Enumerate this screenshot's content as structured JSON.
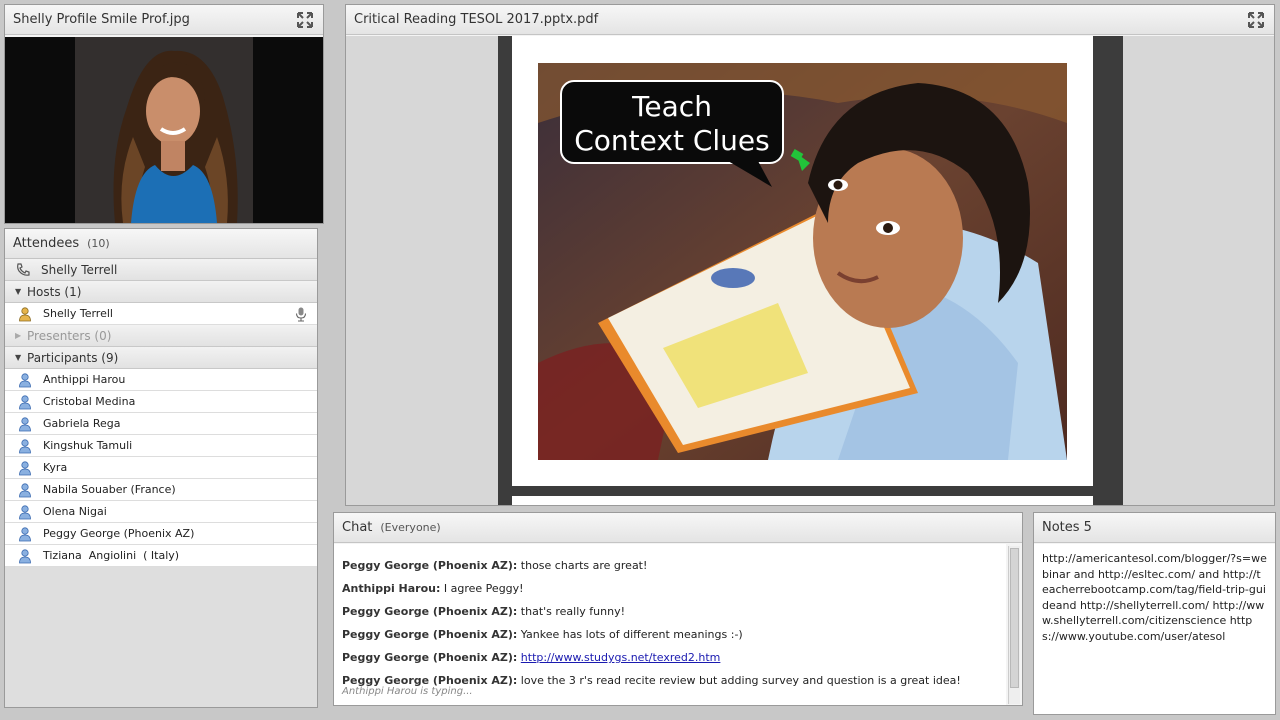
{
  "camera": {
    "title": "Shelly Profile Smile Prof.jpg"
  },
  "share": {
    "title": "Critical Reading TESOL 2017.pptx.pdf",
    "slide": {
      "bubble_line1": "Teach",
      "bubble_line2": "Context Clues"
    }
  },
  "attendees": {
    "title": "Attendees",
    "count": "(10)",
    "me": "Shelly Terrell",
    "hosts_label": "Hosts (1)",
    "hosts": [
      "Shelly Terrell"
    ],
    "presenters_label": "Presenters (0)",
    "participants_label": "Participants (9)",
    "participants": [
      "Anthippi Harou",
      "Cristobal Medina",
      "Gabriela Rega",
      "Kingshuk Tamuli",
      "Kyra",
      "Nabila Souaber (France)",
      "Olena Nigai",
      "Peggy George (Phoenix AZ)",
      "Tiziana  Angiolini  ( Italy)"
    ]
  },
  "chat": {
    "title": "Chat",
    "scope": "(Everyone)",
    "messages": [
      {
        "who": "Peggy George (Phoenix AZ):",
        "text": "those charts are great!"
      },
      {
        "who": "Anthippi Harou:",
        "text": "I agree Peggy!"
      },
      {
        "who": "Peggy George (Phoenix AZ):",
        "text": "that's really funny!"
      },
      {
        "who": "Peggy George (Phoenix AZ):",
        "text": "Yankee has lots of different meanings :-)"
      },
      {
        "who": "Peggy George (Phoenix AZ):",
        "link": "http://www.studygs.net/texred2.htm"
      },
      {
        "who": "Peggy George (Phoenix AZ):",
        "text": "love the 3 r's read recite review but adding survey and question is a great idea!"
      }
    ],
    "typing": "Anthippi Harou is typing..."
  },
  "notes": {
    "title": "Notes 5",
    "text": "http://americantesol.com/blogger/?s=webinar and http://esltec.com/ and http://teacherrebootcamp.com/tag/field-trip-guideand http://shellyterrell.com/ http://www.shellyterrell.com/citizenscience https://www.youtube.com/user/atesol"
  },
  "colors": {
    "link": "#1a1ab0",
    "arrow": "#22c43a",
    "slide_bg": "#ffffff",
    "pod_border": "#9a9a9a"
  }
}
